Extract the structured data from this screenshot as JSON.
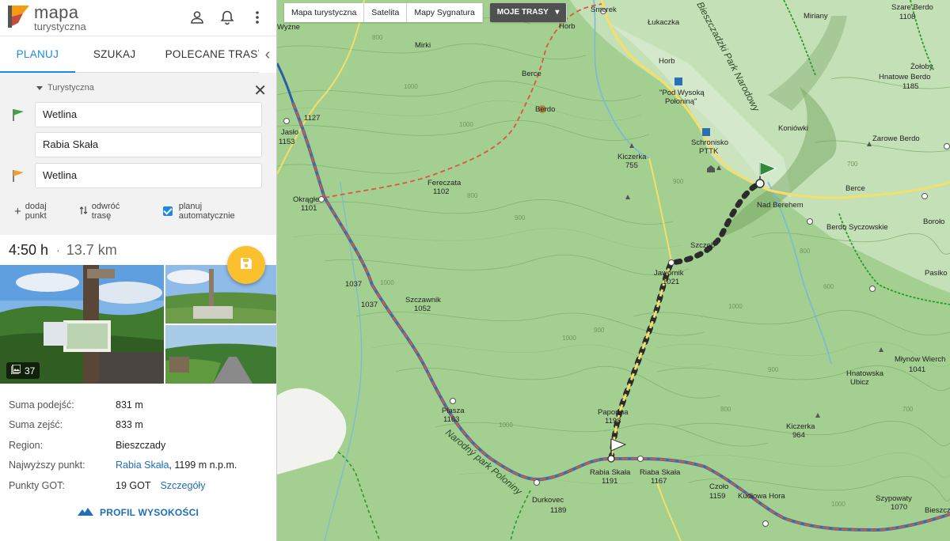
{
  "app": {
    "logo_line1": "mapa",
    "logo_line2": "turystyczna"
  },
  "header_icons": [
    "user-icon",
    "bell-icon",
    "more-vert-icon"
  ],
  "tabs": [
    {
      "label": "PLANUJ",
      "active": true
    },
    {
      "label": "SZUKAJ",
      "active": false
    },
    {
      "label": "POLECANE TRASY",
      "active": false
    }
  ],
  "planner": {
    "mode": "Turystyczna",
    "waypoints": [
      "Wetlina",
      "Rabia Skała",
      "Wetlina"
    ],
    "add_point": "dodaj punkt",
    "reverse_route": "odwróć trasę",
    "auto_plan": "planuj automatycznie",
    "auto_plan_checked": true
  },
  "summary": {
    "time": "4:50 h",
    "separator": "·",
    "distance": "13.7 km"
  },
  "photos": {
    "count": "37"
  },
  "info": [
    {
      "key": "Suma podejść:",
      "value": "831 m"
    },
    {
      "key": "Suma zejść:",
      "value": "833 m"
    },
    {
      "key": "Region:",
      "value": "Bieszczady"
    },
    {
      "key": "Najwyższy punkt:",
      "link": "Rabia Skała",
      "value": ", 1199 m n.p.m."
    },
    {
      "key": "Punkty GOT:",
      "value": "19 GOT",
      "link": "Szczegóły"
    }
  ],
  "profile_button": "PROFIL WYSOKOŚCI",
  "map_controls": [
    "Mapa turystyczna",
    "Satelita",
    "Mapy Sygnatura",
    "MOJE TRASY"
  ],
  "map_labels": [
    {
      "t": "Smerek"
    },
    {
      "t": "Horb"
    },
    {
      "t": "Łukaczka"
    },
    {
      "t": "Horb"
    },
    {
      "t": "Berce"
    },
    {
      "t": "\"Pod Wysoką"
    },
    {
      "t": "Połoniną\""
    },
    {
      "t": "Schronisko"
    },
    {
      "t": "PTTK"
    },
    {
      "t": "Berdo"
    },
    {
      "t": "Kiczerka"
    },
    {
      "t": "755"
    },
    {
      "t": "Koniówki"
    },
    {
      "t": "Fereczata"
    },
    {
      "t": "1102"
    },
    {
      "t": "Okrągłe"
    },
    {
      "t": "1101"
    },
    {
      "t": "Jawornik"
    },
    {
      "t": "1021"
    },
    {
      "t": "Szczob"
    },
    {
      "t": "Nad Berehem"
    },
    {
      "t": "Berce"
    },
    {
      "t": "Berdo Syczowskie"
    },
    {
      "t": "1037"
    },
    {
      "t": "1037"
    },
    {
      "t": "Szczawnik"
    },
    {
      "t": "1052"
    },
    {
      "t": "Płasza"
    },
    {
      "t": "1163"
    },
    {
      "t": "Paportna"
    },
    {
      "t": "1198"
    },
    {
      "t": "Rabia Skała"
    },
    {
      "t": "1191"
    },
    {
      "t": "Riaba Skała"
    },
    {
      "t": "1167"
    },
    {
      "t": "Durkovec"
    },
    {
      "t": "1189"
    },
    {
      "t": "Czoło"
    },
    {
      "t": "1159"
    },
    {
      "t": "Kudłowa Hora"
    },
    {
      "t": "Kiczerka"
    },
    {
      "t": "964"
    },
    {
      "t": "Hnatowska"
    },
    {
      "t": "Ubicz"
    },
    {
      "t": "Młynów Wierch"
    },
    {
      "t": "1041"
    },
    {
      "t": "Szare Berdo"
    },
    {
      "t": "1108"
    },
    {
      "t": "Miriany"
    },
    {
      "t": "Żołoby"
    },
    {
      "t": "Hnatowe Berdo"
    },
    {
      "t": "1185"
    },
    {
      "t": "Zarowe Berdo"
    },
    {
      "t": "Szypowaty"
    },
    {
      "t": "1070"
    },
    {
      "t": "Bieszcz"
    },
    {
      "t": "Wyżne"
    },
    {
      "t": "Mirki"
    },
    {
      "t": "1127"
    },
    {
      "t": "Jasło"
    },
    {
      "t": "1153"
    },
    {
      "t": "Bieszczadzki Park Narodowy"
    },
    {
      "t": "Narodný park Poloniny"
    },
    {
      "t": "Boroło"
    },
    {
      "t": "Pasiko"
    }
  ]
}
